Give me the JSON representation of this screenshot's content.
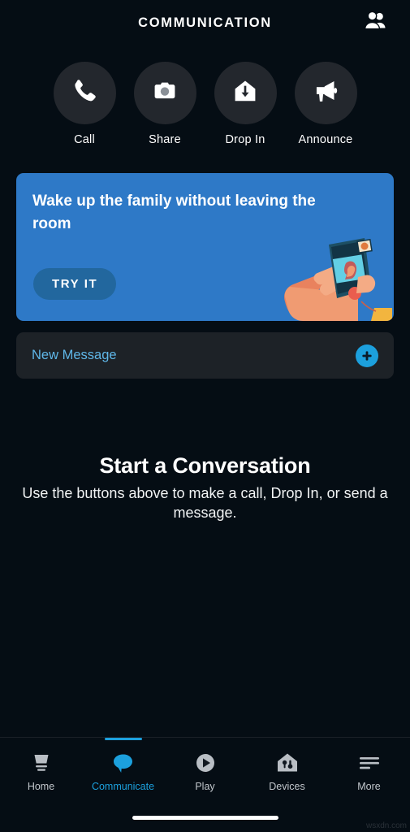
{
  "header": {
    "title": "COMMUNICATION",
    "contacts_icon": "contacts-people-icon"
  },
  "actions": [
    {
      "label": "Call",
      "icon": "phone-icon"
    },
    {
      "label": "Share",
      "icon": "camera-icon"
    },
    {
      "label": "Drop In",
      "icon": "house-down-arrow-icon"
    },
    {
      "label": "Announce",
      "icon": "megaphone-icon"
    }
  ],
  "promo": {
    "title": "Wake up the family without leaving the room",
    "cta_label": "TRY IT",
    "art": "hand-holding-phone-video-call-illustration",
    "bg_color": "#2e79c7",
    "cta_color": "#22679e"
  },
  "new_message": {
    "label": "New Message",
    "add_icon": "plus-circle-icon",
    "label_color": "#5fb7e8",
    "accent_color": "#1ca0dd"
  },
  "empty_state": {
    "title": "Start a Conversation",
    "subtitle": "Use the buttons above to make a call, Drop In, or send a message."
  },
  "bottom_nav": {
    "active_color": "#1ca0dd",
    "inactive_color": "#c2c7cc",
    "items": [
      {
        "label": "Home",
        "icon": "echo-device-icon",
        "active": false
      },
      {
        "label": "Communicate",
        "icon": "speech-bubble-icon",
        "active": true
      },
      {
        "label": "Play",
        "icon": "play-circle-icon",
        "active": false
      },
      {
        "label": "Devices",
        "icon": "smart-home-icon",
        "active": false
      },
      {
        "label": "More",
        "icon": "hamburger-menu-icon",
        "active": false
      }
    ]
  },
  "watermark": "wsxdn.com"
}
